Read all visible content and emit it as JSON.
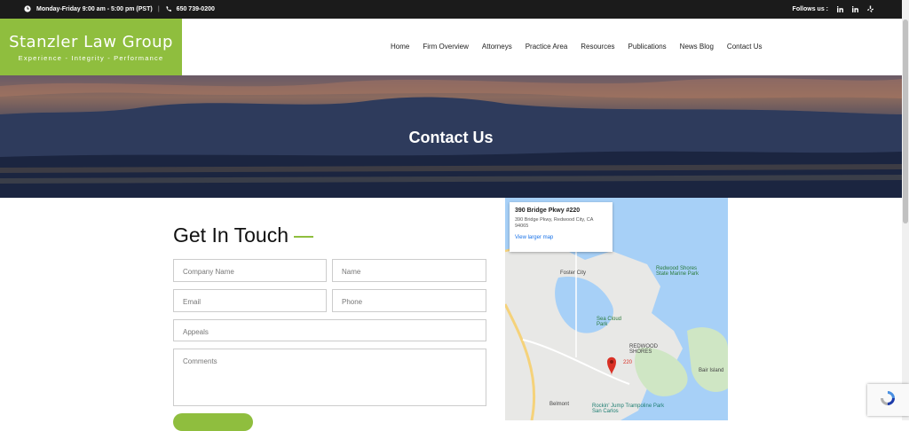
{
  "topbar": {
    "hours": "Monday-Friday 9:00 am - 5:00 pm (PST)",
    "phone": "650 739-0200",
    "follow_label": "Follows us :"
  },
  "brand": {
    "name": "Stanzler Law Group",
    "tagline": "Experience - Integrity - Performance",
    "accent": "#8fbe3e"
  },
  "nav": {
    "items": [
      "Home",
      "Firm Overview",
      "Attorneys",
      "Practice Area",
      "Resources",
      "Publications",
      "News Blog",
      "Contact Us"
    ]
  },
  "hero": {
    "title": "Contact Us"
  },
  "form": {
    "title": "Get In Touch",
    "company_placeholder": "Company Name",
    "name_placeholder": "Name",
    "email_placeholder": "Email",
    "phone_placeholder": "Phone",
    "appeals_placeholder": "Appeals",
    "comments_placeholder": "Comments"
  },
  "map": {
    "card_title": "390 Bridge Pkwy #220",
    "card_address": "390 Bridge Pkwy, Redwood City, CA 94065",
    "card_link": "View larger map",
    "labels": {
      "foster_city": "Foster City",
      "redwood_shores_park": "Redwood Shores State Marine Park",
      "sea_cloud": "Sea Cloud Park",
      "redwood_shores": "REDWOOD SHORES",
      "pin": "220",
      "bair_island": "Bair Island",
      "belmont": "Belmont",
      "rockin": "Rockin' Jump Trampoline Park San Carlos"
    }
  }
}
